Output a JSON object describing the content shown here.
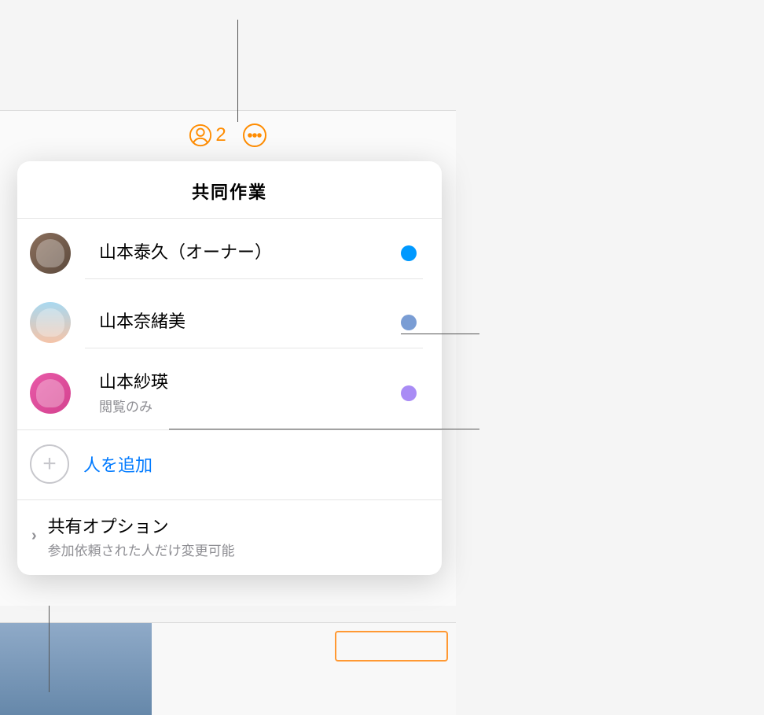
{
  "toolbar": {
    "collab_count": "2"
  },
  "popover": {
    "title": "共同作業",
    "participants": [
      {
        "name": "山本泰久（オーナー）",
        "subtitle": "",
        "color": "#0099ff",
        "avatar_variant": "a1"
      },
      {
        "name": "山本奈緒美",
        "subtitle": "",
        "color": "#7a9dd4",
        "avatar_variant": "a2"
      },
      {
        "name": "山本紗瑛",
        "subtitle": "閲覧のみ",
        "color": "#a98cf5",
        "avatar_variant": "a3"
      }
    ],
    "add_label": "人を追加",
    "options": {
      "title": "共有オプション",
      "subtitle": "参加依頼された人だけ変更可能"
    }
  }
}
